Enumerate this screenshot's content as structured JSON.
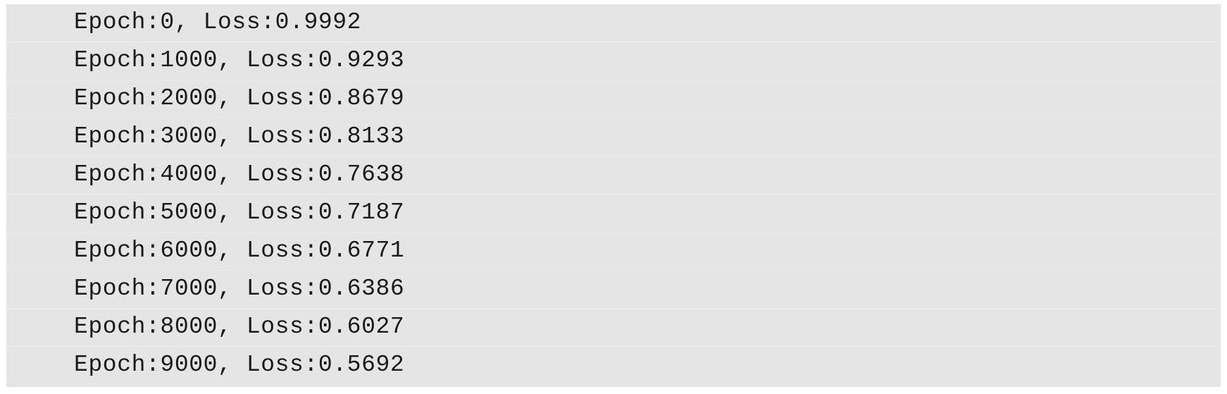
{
  "output": {
    "lines": [
      "Epoch:0, Loss:0.9992",
      "Epoch:1000, Loss:0.9293",
      "Epoch:2000, Loss:0.8679",
      "Epoch:3000, Loss:0.8133",
      "Epoch:4000, Loss:0.7638",
      "Epoch:5000, Loss:0.7187",
      "Epoch:6000, Loss:0.6771",
      "Epoch:7000, Loss:0.6386",
      "Epoch:8000, Loss:0.6027",
      "Epoch:9000, Loss:0.5692"
    ]
  }
}
